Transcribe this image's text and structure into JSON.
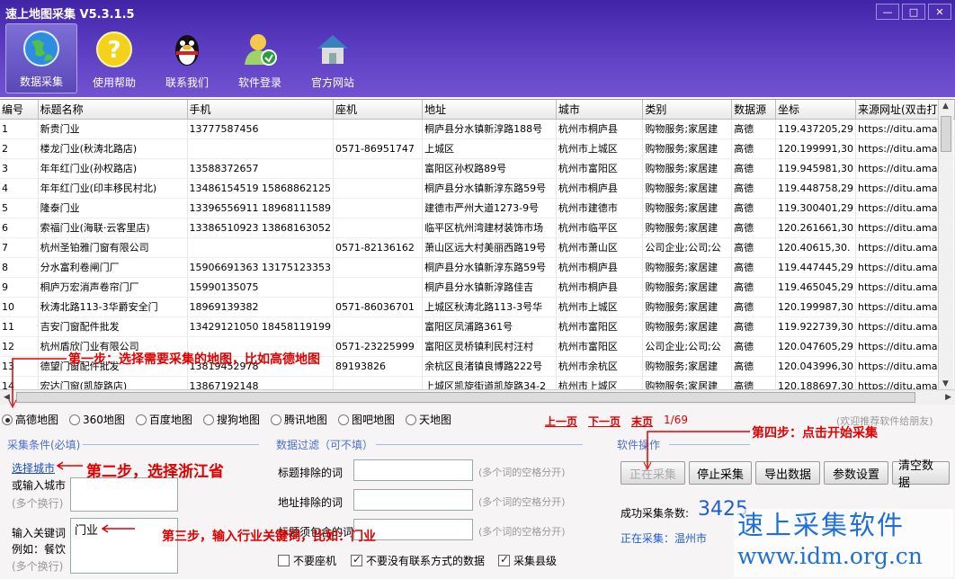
{
  "app": {
    "title": "速上地图采集 V5.3.1.5"
  },
  "window": {
    "min": "—",
    "max": "□",
    "close": "✕"
  },
  "toolbar": [
    {
      "label": "数据采集",
      "icon": "globe-icon"
    },
    {
      "label": "使用帮助",
      "icon": "question-icon"
    },
    {
      "label": "联系我们",
      "icon": "qq-penguin-icon"
    },
    {
      "label": "软件登录",
      "icon": "user-login-icon"
    },
    {
      "label": "官方网站",
      "icon": "house-icon"
    }
  ],
  "table": {
    "columns": [
      "编号",
      "标题名称",
      "手机",
      "座机",
      "地址",
      "城市",
      "类别",
      "数据源",
      "坐标",
      "来源网址(双击打"
    ],
    "rows": [
      [
        "1",
        "新贵门业",
        "13777587456",
        "",
        "桐庐县分水镇新淳路188号",
        "杭州市桐庐县",
        "购物服务;家居建",
        "高德",
        "119.437205,29",
        "https://ditu.amap.c"
      ],
      [
        "2",
        "楼龙门业(秋涛北路店)",
        "",
        "0571-86951747",
        "上城区",
        "杭州市上城区",
        "购物服务;家居建",
        "高德",
        "120.199991,30",
        "https://ditu.amap.c"
      ],
      [
        "3",
        "年年红门业(孙权路店)",
        "13588372657",
        "",
        "富阳区孙权路89号",
        "杭州市富阳区",
        "购物服务;家居建",
        "高德",
        "119.945981,30",
        "https://ditu.amap.c"
      ],
      [
        "4",
        "年年红门业(印丰移民村北)",
        "13486154519 15868862125",
        "",
        "桐庐县分水镇新淳东路59号",
        "杭州市桐庐县",
        "购物服务;家居建",
        "高德",
        "119.448758,29",
        "https://ditu.amap.c"
      ],
      [
        "5",
        "隆泰门业",
        "13396556911 18968111589",
        "",
        "建德市严州大道1273-9号",
        "杭州市建德市",
        "购物服务;家居建",
        "高德",
        "119.300401,29",
        "https://ditu.amap.c"
      ],
      [
        "6",
        "索福门业(海联·云客里店)",
        "13386510923 13868163052",
        "",
        "临平区杭州湾建材装饰市场",
        "杭州市临平区",
        "购物服务;家居建",
        "高德",
        "120.261661,30",
        "https://ditu.amap.c"
      ],
      [
        "7",
        "杭州圣铂雅门窗有限公司",
        "",
        "0571-82136162",
        "萧山区远大村美丽西路19号",
        "杭州市萧山区",
        "公司企业;公司;公",
        "高德",
        "120.40615,30.",
        "https://ditu.amap.c"
      ],
      [
        "8",
        "分水富利卷闸门厂",
        "15906691363 13175123353",
        "",
        "桐庐县分水镇新淳东路59号",
        "杭州市桐庐县",
        "购物服务;家居建",
        "高德",
        "119.447445,29",
        "https://ditu.amap.c"
      ],
      [
        "9",
        "桐庐万宏消声卷帘门厂",
        "15990135075",
        "",
        "桐庐县分水镇新淳路佳吉",
        "杭州市桐庐县",
        "购物服务;家居建",
        "高德",
        "119.465045,29",
        "https://ditu.amap.c"
      ],
      [
        "10",
        "秋涛北路113-3华爵安全门",
        "18969139382",
        "0571-86036701",
        "上城区秋涛北路113-3号华",
        "杭州市上城区",
        "购物服务;家居建",
        "高德",
        "120.199987,30",
        "https://ditu.amap.c"
      ],
      [
        "11",
        "吉安门窗配件批发",
        "13429121050 18458119199",
        "",
        "富阳区凤浦路361号",
        "杭州市富阳区",
        "购物服务;家居建",
        "高德",
        "119.922739,30",
        "https://ditu.amap.c"
      ],
      [
        "12",
        "杭州盾欣门业有限公司",
        "",
        "0571-23225999",
        "富阳区灵桥镇利民村汪村",
        "杭州市富阳区",
        "公司企业;公司;公",
        "高德",
        "120.047605,29",
        "https://ditu.amap.c"
      ],
      [
        "13",
        "德望门窗配件批发",
        "13819452978",
        "89193826",
        "余杭区良渚镇良博路222号",
        "杭州市余杭区",
        "购物服务;家居建",
        "高德",
        "120.043996,30",
        "https://ditu.amap.c"
      ],
      [
        "14",
        "宏达门窗(凯旋路店)",
        "13867192148",
        "",
        "上城区凯旋街道凯旋路34-2",
        "杭州市上城区",
        "购物服务;家居建",
        "高德",
        "120.188697,30",
        "https://ditu.amap.c"
      ]
    ]
  },
  "maps": {
    "options": [
      "高德地图",
      "360地图",
      "百度地图",
      "搜狗地图",
      "腾讯地图",
      "图吧地图",
      "天地图"
    ],
    "selected": 0
  },
  "pager": {
    "prev": "上一页",
    "next": "下一页",
    "last": "末页",
    "page": "1/69"
  },
  "welcome": "(欢迎推荐软件给朋友)",
  "conditions": {
    "title": "采集条件(必填)",
    "select_city": "选择城市",
    "or_city": "或输入城市",
    "multi1": "(多个换行)",
    "keyword_label": "输入关键词",
    "example": "例如：餐饮",
    "multi2": "(多个换行)",
    "keyword_value": "门业"
  },
  "filter": {
    "title": "数据过滤（可不填）",
    "title_exclude": "标题排除的词",
    "addr_exclude": "地址排除的词",
    "title_include": "标题须包含的词",
    "hint": "(多个词的空格分开)",
    "chk_no_landline": "不要座机",
    "chk_no_contact": "不要没有联系方式的数据",
    "chk_county": "采集县级"
  },
  "ops": {
    "title": "软件操作",
    "collecting": "正在采集",
    "stop": "停止采集",
    "export": "导出数据",
    "settings": "参数设置",
    "clear": "清空数据",
    "success_label": "成功采集条数:",
    "success_count": "3425",
    "status": "正在采集：温州市"
  },
  "steps": {
    "s1": "第一步：选择需要采集的地图，比如高德地图",
    "s2": "第二步，选择浙江省",
    "s3": "第三步，输入行业关键词，比如：门业",
    "s4": "第四步：点击开始采集"
  },
  "watermark": {
    "line1": "速上采集软件",
    "line2": "www.idm.org.cn"
  },
  "colors": {
    "header": "#4a2db5",
    "accent_red": "#e00000",
    "count_blue": "#1e5fd0"
  }
}
